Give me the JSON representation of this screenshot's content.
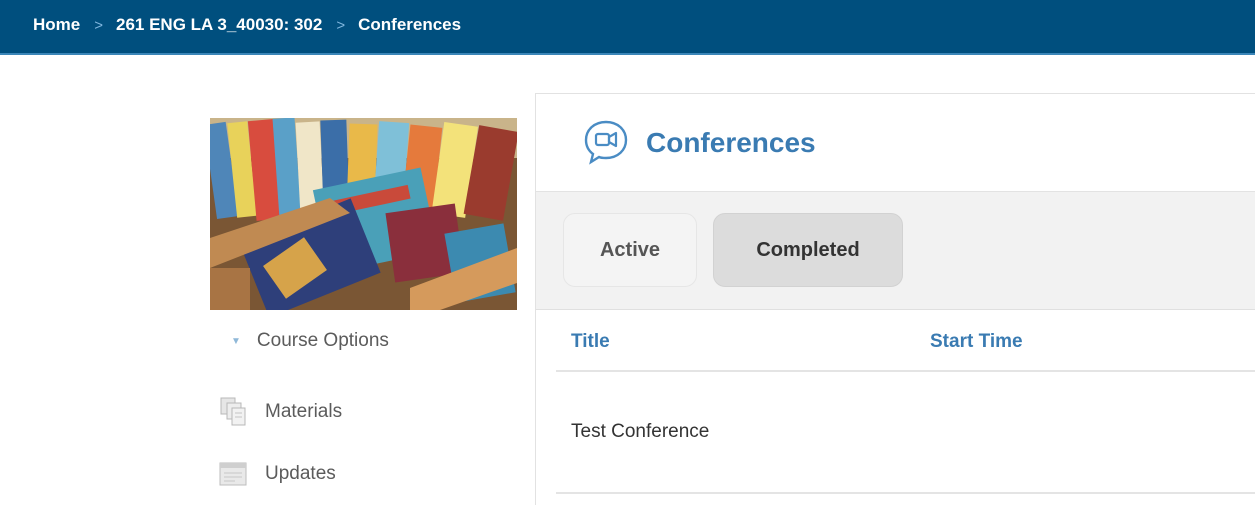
{
  "breadcrumb": {
    "items": [
      "Home",
      "261 ENG LA 3_40030: 302",
      "Conferences"
    ],
    "separator": ">"
  },
  "sidebar": {
    "course_options_label": "Course Options",
    "items": [
      {
        "label": "Materials",
        "icon": "materials-icon"
      },
      {
        "label": "Updates",
        "icon": "updates-icon"
      }
    ]
  },
  "main": {
    "title": "Conferences",
    "icon": "video-chat-icon",
    "tabs": [
      {
        "label": "Active"
      },
      {
        "label": "Completed",
        "selected": true
      }
    ],
    "table": {
      "columns": [
        "Title",
        "Start Time"
      ],
      "rows": [
        {
          "title": "Test Conference",
          "start_time": ""
        }
      ]
    }
  },
  "colors": {
    "header_bg": "#004f7e",
    "accent": "#3a7bb2",
    "tab_selected_bg": "#dcdcdc"
  }
}
